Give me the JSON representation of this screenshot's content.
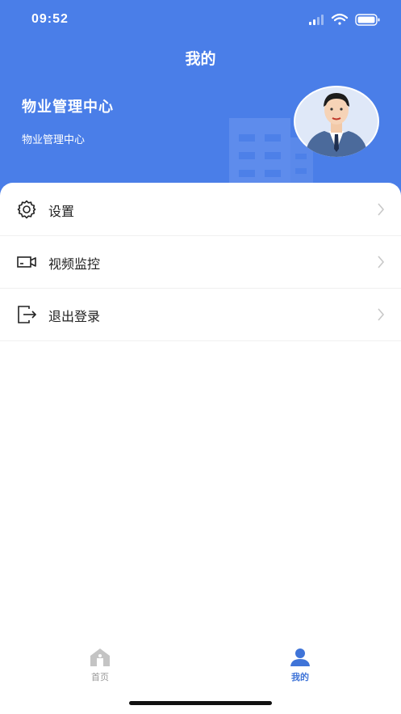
{
  "status_bar": {
    "time": "09:52"
  },
  "header": {
    "title": "我的",
    "org_name": "物业管理中心",
    "org_subtitle": "物业管理中心"
  },
  "menu": [
    {
      "label": "设置",
      "icon": "gear-icon"
    },
    {
      "label": "视频监控",
      "icon": "video-camera-icon"
    },
    {
      "label": "退出登录",
      "icon": "logout-icon"
    }
  ],
  "tabbar": [
    {
      "label": "首页",
      "icon": "home-icon",
      "active": false
    },
    {
      "label": "我的",
      "icon": "user-icon",
      "active": true
    }
  ],
  "colors": {
    "header_bg": "#4a7ee8",
    "active_tab": "#3f74d8",
    "inactive_tab": "#999999"
  }
}
